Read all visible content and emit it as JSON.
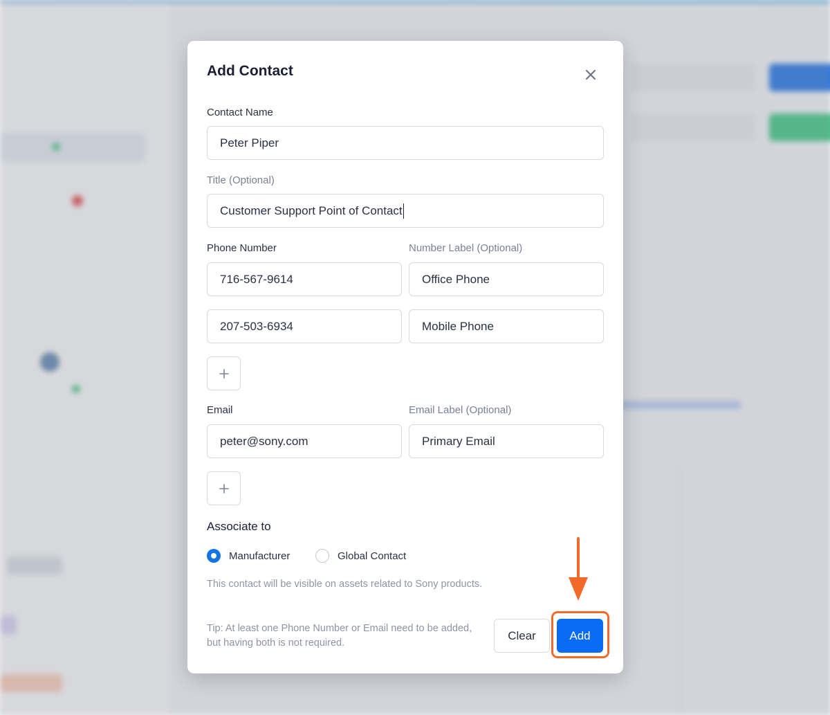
{
  "modal": {
    "title": "Add Contact",
    "close_icon": "close-icon",
    "contact_name": {
      "label": "Contact Name",
      "value": "Peter Piper"
    },
    "title_field": {
      "label": "Title (Optional)",
      "value": "Customer Support Point of Contact"
    },
    "phone": {
      "label": "Phone Number",
      "number_label": "Number Label (Optional)",
      "rows": [
        {
          "number": "716-567-9614",
          "label": "Office Phone"
        },
        {
          "number": "207-503-6934",
          "label": "Mobile Phone"
        }
      ],
      "add_icon": "plus-icon"
    },
    "email": {
      "label": "Email",
      "email_label": "Email Label (Optional)",
      "rows": [
        {
          "email": "peter@sony.com",
          "label": "Primary Email"
        }
      ],
      "add_icon": "plus-icon"
    },
    "associate": {
      "title": "Associate to",
      "options": [
        {
          "label": "Manufacturer",
          "selected": true
        },
        {
          "label": "Global Contact",
          "selected": false
        }
      ],
      "helper": "This contact will be visible on assets related to Sony products."
    },
    "tip": "Tip: At least one Phone Number or Email need to be added, but having both is not required.",
    "buttons": {
      "clear": "Clear",
      "add": "Add"
    }
  },
  "annotation": {
    "arrow_color": "#f26a2a",
    "highlight_target": "Add"
  },
  "colors": {
    "primary": "#0a6cf5",
    "annotation": "#f26a2a"
  }
}
